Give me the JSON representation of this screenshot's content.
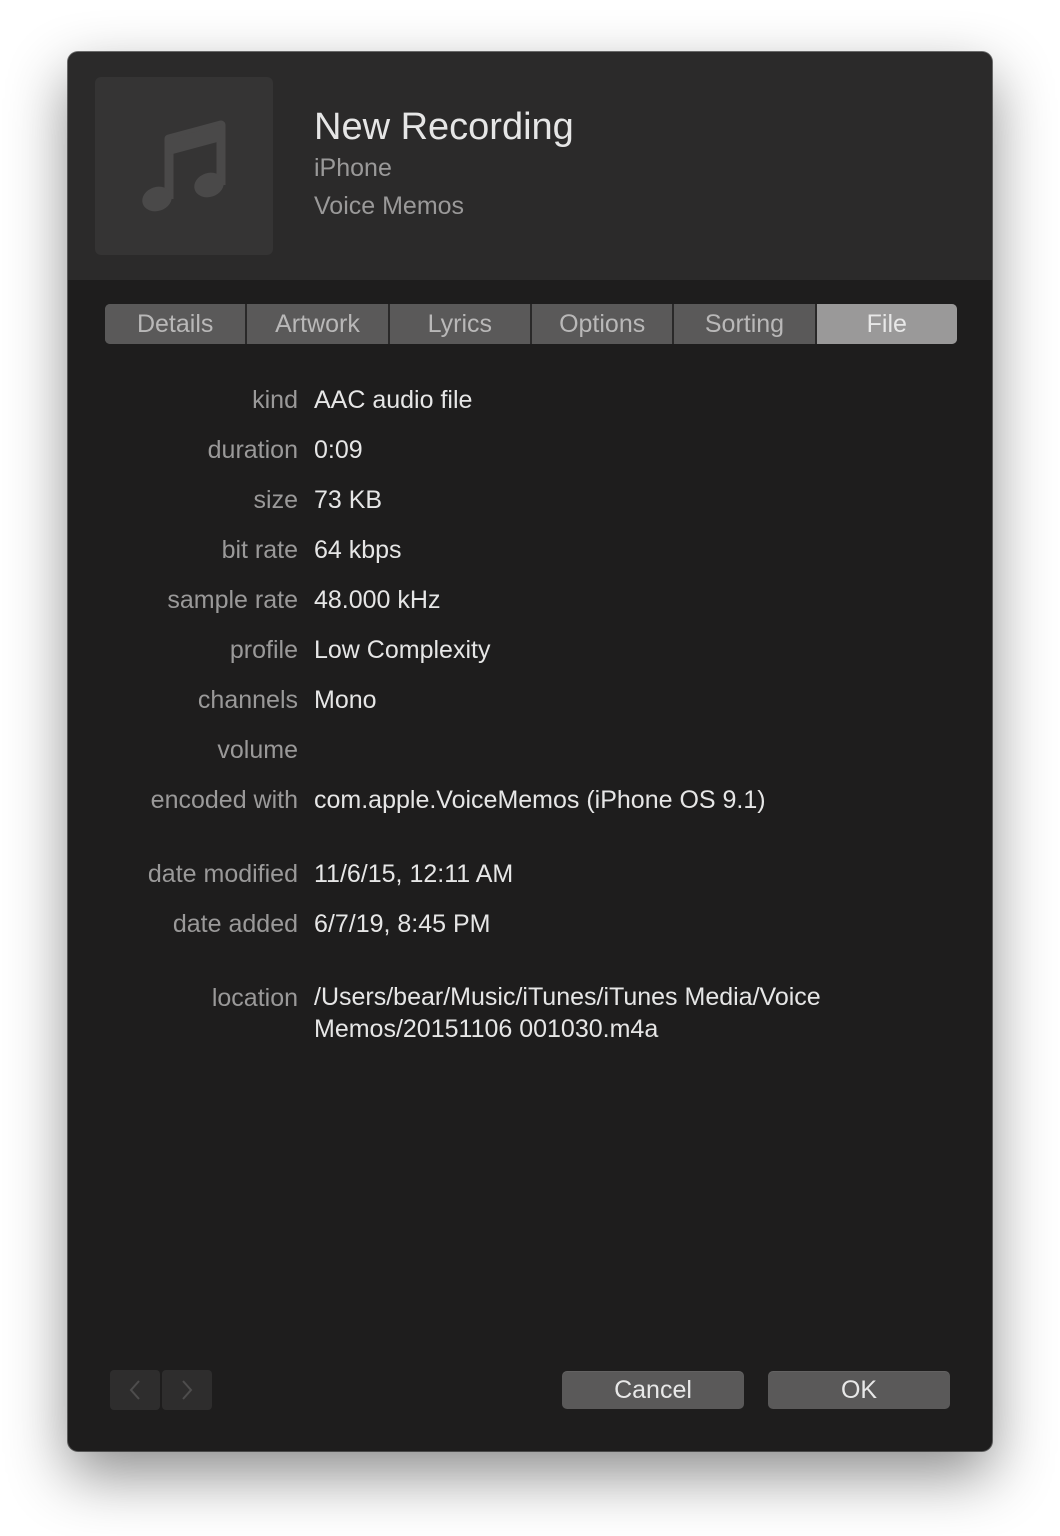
{
  "header": {
    "title": "New Recording",
    "artist": "iPhone",
    "album": "Voice Memos",
    "artwork_icon": "music-note-icon"
  },
  "tabs": [
    {
      "label": "Details",
      "selected": false
    },
    {
      "label": "Artwork",
      "selected": false
    },
    {
      "label": "Lyrics",
      "selected": false
    },
    {
      "label": "Options",
      "selected": false
    },
    {
      "label": "Sorting",
      "selected": false
    },
    {
      "label": "File",
      "selected": true
    }
  ],
  "file_info": {
    "kind": {
      "label": "kind",
      "value": "AAC audio file"
    },
    "duration": {
      "label": "duration",
      "value": "0:09"
    },
    "size": {
      "label": "size",
      "value": "73 KB"
    },
    "bit_rate": {
      "label": "bit rate",
      "value": "64 kbps"
    },
    "sample_rate": {
      "label": "sample rate",
      "value": "48.000 kHz"
    },
    "profile": {
      "label": "profile",
      "value": "Low Complexity"
    },
    "channels": {
      "label": "channels",
      "value": "Mono"
    },
    "volume": {
      "label": "volume",
      "value": ""
    },
    "encoded_with": {
      "label": "encoded with",
      "value": "com.apple.VoiceMemos (iPhone OS 9.1)"
    },
    "date_modified": {
      "label": "date modified",
      "value": "11/6/15, 12:11 AM"
    },
    "date_added": {
      "label": "date added",
      "value": "6/7/19, 8:45 PM"
    },
    "location": {
      "label": "location",
      "value": "/Users/bear/Music/iTunes/iTunes Media/Voice Memos/20151106 001030.m4a"
    }
  },
  "footer": {
    "prev_icon": "chevron-left-icon",
    "next_icon": "chevron-right-icon",
    "cancel_label": "Cancel",
    "ok_label": "OK"
  },
  "colors": {
    "window_bg": "#1e1d1d",
    "header_bg": "#2b2a2a",
    "selected_tab": "#9a9999",
    "label_text": "#9a9999",
    "value_text": "#e6e6e6"
  }
}
